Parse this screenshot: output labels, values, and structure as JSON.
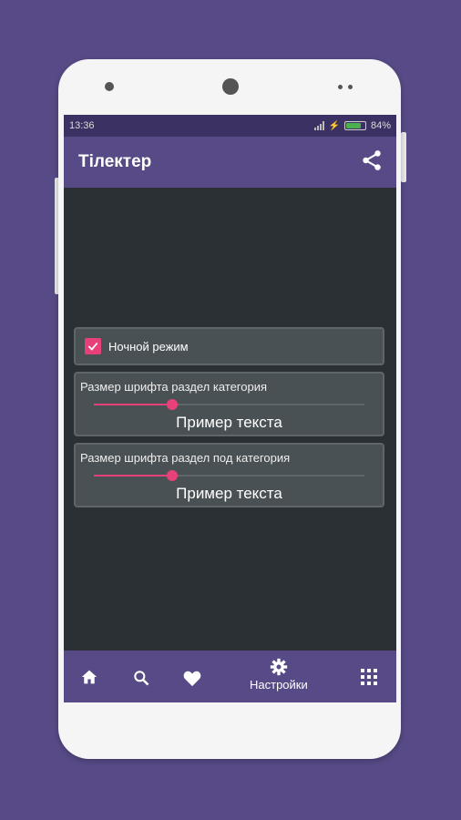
{
  "statusbar": {
    "time": "13:36",
    "battery": "84%",
    "battery_level": 0.84
  },
  "appbar": {
    "title": "Тілектер",
    "share_icon": "share-icon"
  },
  "settings": {
    "night_mode": {
      "label": "Ночной режим",
      "checked": true
    },
    "font_category": {
      "label": "Размер шрифта раздел категория",
      "value": 0.29,
      "sample": "Пример текста"
    },
    "font_subcategory": {
      "label": "Размер шрифта раздел под категория",
      "value": 0.29,
      "sample": "Пример текста"
    }
  },
  "bottomnav": {
    "items": [
      {
        "icon": "home-icon",
        "label": ""
      },
      {
        "icon": "search-icon",
        "label": ""
      },
      {
        "icon": "heart-icon",
        "label": ""
      },
      {
        "icon": "gear-icon",
        "label": "Настройки"
      },
      {
        "icon": "grid-icon",
        "label": ""
      }
    ]
  },
  "colors": {
    "accent": "#e8417a",
    "primary": "#574a86",
    "background": "#2a3034",
    "card": "#4a5154"
  }
}
